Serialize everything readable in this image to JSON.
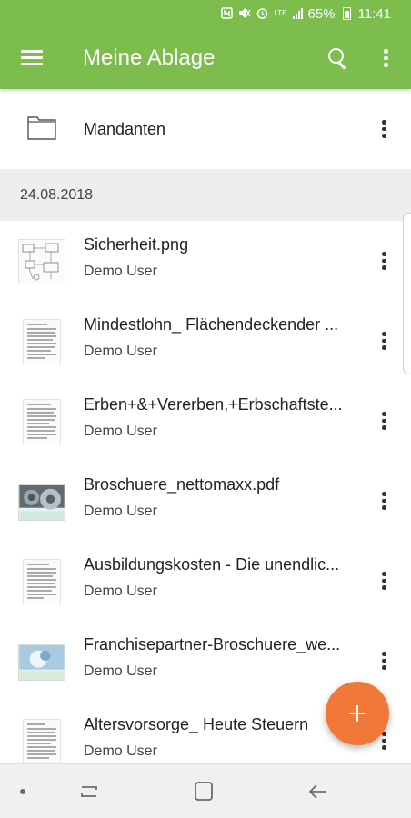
{
  "status_bar": {
    "battery_percent": "65%",
    "time": "11:41",
    "network": "LTE",
    "icons": [
      "nfc-icon",
      "mute-icon",
      "alarm-icon",
      "lte-icon",
      "signal-icon",
      "battery-icon"
    ]
  },
  "app_bar": {
    "title": "Meine Ablage",
    "icons": [
      "menu-icon",
      "search-icon",
      "more-vert-icon"
    ]
  },
  "folder": {
    "name": "Mandanten",
    "icon": "folder-icon"
  },
  "section": {
    "date": "24.08.2018"
  },
  "files": [
    {
      "name": "Sicherheit.png",
      "owner": "Demo User",
      "thumb": "diagram"
    },
    {
      "name": "Mindestlohn_ Flächendeckender ...",
      "owner": "Demo User",
      "thumb": "document"
    },
    {
      "name": "Erben+&+Vererben,+Erbschaftste...",
      "owner": "Demo User",
      "thumb": "document"
    },
    {
      "name": "Broschuere_nettomaxx.pdf",
      "owner": "Demo User",
      "thumb": "photo-gears"
    },
    {
      "name": "Ausbildungskosten - Die unendlic...",
      "owner": "Demo User",
      "thumb": "document"
    },
    {
      "name": "Franchisepartner-Broschuere_we...",
      "owner": "Demo User",
      "thumb": "photo-blue"
    },
    {
      "name": "Altersvorsorge_ Heute Steuern",
      "owner": "Demo User",
      "thumb": "document"
    }
  ],
  "fab": {
    "icon": "plus-icon"
  },
  "nav_bar": {
    "icons": [
      "nav-dot-icon",
      "recents-icon",
      "home-icon",
      "back-icon"
    ]
  },
  "colors": {
    "primary": "#7cbd4e",
    "accent": "#f07839",
    "section_bg": "#eceeef"
  }
}
